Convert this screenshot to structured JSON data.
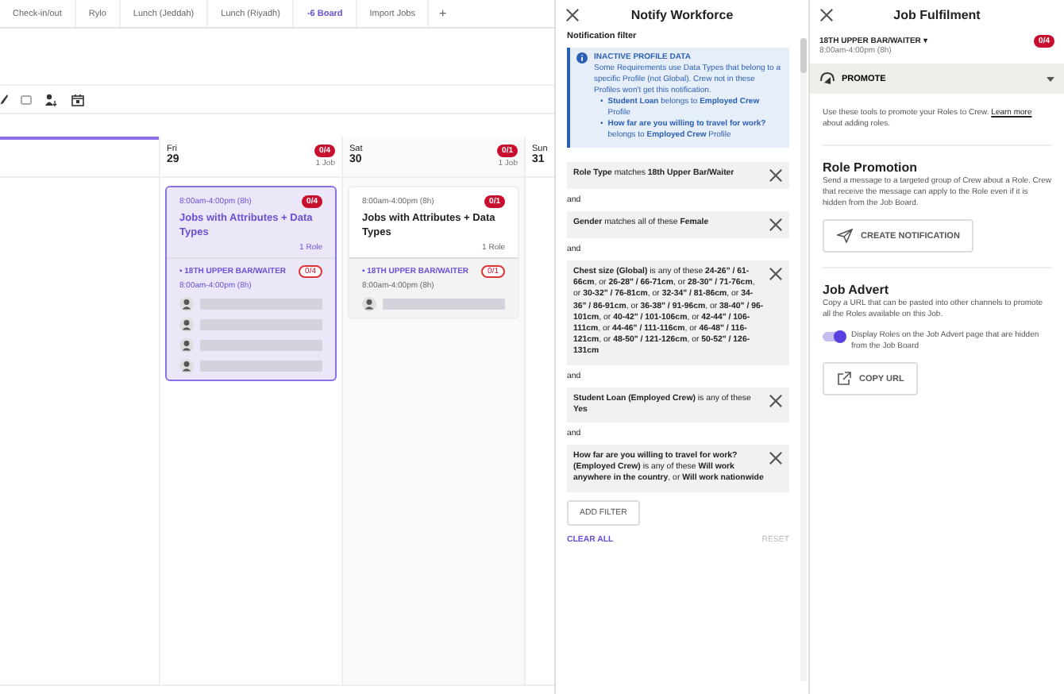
{
  "tabs": [
    {
      "label": "Check-in/out",
      "selected": false
    },
    {
      "label": "Rylo",
      "selected": false
    },
    {
      "label": "Lunch (Jeddah)",
      "selected": false
    },
    {
      "label": "Lunch (Riyadh)",
      "selected": false
    },
    {
      "label": "-6 Board",
      "selected": true
    },
    {
      "label": "Import Jobs",
      "selected": false
    }
  ],
  "add_tab": "+",
  "calendar": {
    "days": [
      {
        "kind": "partial",
        "selected": true
      },
      {
        "kind": "day",
        "weekday": "Fri",
        "date": "29",
        "badge": "0/4",
        "jobs_count": "1 Job",
        "jobs": [
          {
            "time": "8:00am-4:00pm (8h)",
            "badge": "0/4",
            "title": "Jobs with Attributes + Data Types",
            "roles_count": "1 Role",
            "selected": true,
            "roles": [
              {
                "name": "• 18TH UPPER BAR/WAITER",
                "badge": "0/4",
                "time": "8:00am-4:00pm (8h)",
                "crew": [
                  {
                    "kind": "placeholder"
                  },
                  {
                    "kind": "placeholder"
                  },
                  {
                    "kind": "placeholder"
                  },
                  {
                    "kind": "placeholder"
                  }
                ]
              }
            ]
          }
        ]
      },
      {
        "kind": "day",
        "weekday": "Sat",
        "date": "30",
        "badge": "0/1",
        "jobs_count": "1 Job",
        "jobs": [
          {
            "time": "8:00am-4:00pm (8h)",
            "badge": "0/1",
            "title": "Jobs with Attributes + Data Types",
            "roles_count": "1 Role",
            "selected": false,
            "roles": [
              {
                "name": "• 18TH UPPER BAR/WAITER",
                "badge": "0/1",
                "time": "8:00am-4:00pm (8h)",
                "crew": [
                  {
                    "kind": "placeholder"
                  }
                ]
              }
            ]
          }
        ]
      },
      {
        "kind": "day",
        "weekday": "Sun",
        "date": "31"
      }
    ]
  },
  "notify": {
    "title": "Notify Workforce",
    "section": "Notification filter",
    "info": {
      "title": "INACTIVE PROFILE DATA",
      "text": "Some Requirements use Data Types that belong to a specific Profile (not Global). Crew not in these Profiles won't get this notification.",
      "items": [
        {
          "bullet": "•",
          "text": "**Student Loan** belongs to **Employed Crew** Profile"
        },
        {
          "bullet": "•",
          "text": "**How far are you willing to travel for work?** belongs to **Employed Crew** Profile"
        }
      ]
    },
    "filters": [
      {
        "text": "**Role Type** matches **18th Upper Bar/Waiter**"
      },
      {
        "joiner": "and",
        "text": "**Gender** matches all of these **Female**"
      },
      {
        "joiner": "and",
        "text": "**Chest size (Global)** is any of these **24-26\" / 61-66cm**, or **26-28\" / 66-71cm**, or **28-30\" / 71-76cm**, or **30-32\" / 76-81cm**, or **32-34\" / 81-86cm**, or **34-36\" / 86-91cm**, or **36-38\" / 91-96cm**, or **38-40\" / 96-101cm**, or **40-42\" / 101-106cm**, or **42-44\" / 106-111cm**, or **44-46\" / 111-116cm**, or **46-48\" / 116-121cm**, or **48-50\" / 121-126cm**, or **50-52\" / 126-131cm**"
      },
      {
        "joiner": "and",
        "text": "**Student Loan (Employed Crew)** is any of these **Yes**"
      },
      {
        "joiner": "and",
        "text": "**How far are you willing to travel for work? (Employed Crew)** is any of these **Will work anywhere in the country**, or **Will work nationwide**"
      }
    ],
    "add_filter": "ADD FILTER",
    "clear_all": "CLEAR ALL",
    "reset": {
      "label": "RESET",
      "disabled": true
    }
  },
  "fulfilment": {
    "title": "Job Fulfilment",
    "role": "18TH UPPER BAR/WAITER",
    "role_caret": "▾",
    "role_time": "8:00am-4:00pm (8h)",
    "badge": "0/4",
    "promote": {
      "label": "PROMOTE",
      "expanded": true
    },
    "intro": "Use these tools to promote your Roles to Crew.",
    "intro_link": "Learn more",
    "intro_tail": "about adding roles.",
    "role_promotion": {
      "heading": "Role Promotion",
      "text": "Send a message to a targeted group of Crew about a Role. Crew that receive the message can apply to the Role even if it is hidden from the Job Board.",
      "button": "CREATE NOTIFICATION"
    },
    "job_advert": {
      "heading": "Job Advert",
      "text": "Copy a URL that can be pasted into other channels to promote all the Roles available on this Job.",
      "toggle": {
        "label": "Display Roles on the Job Advert page that are hidden from the Job Board",
        "on": true
      },
      "button": "COPY URL"
    }
  }
}
